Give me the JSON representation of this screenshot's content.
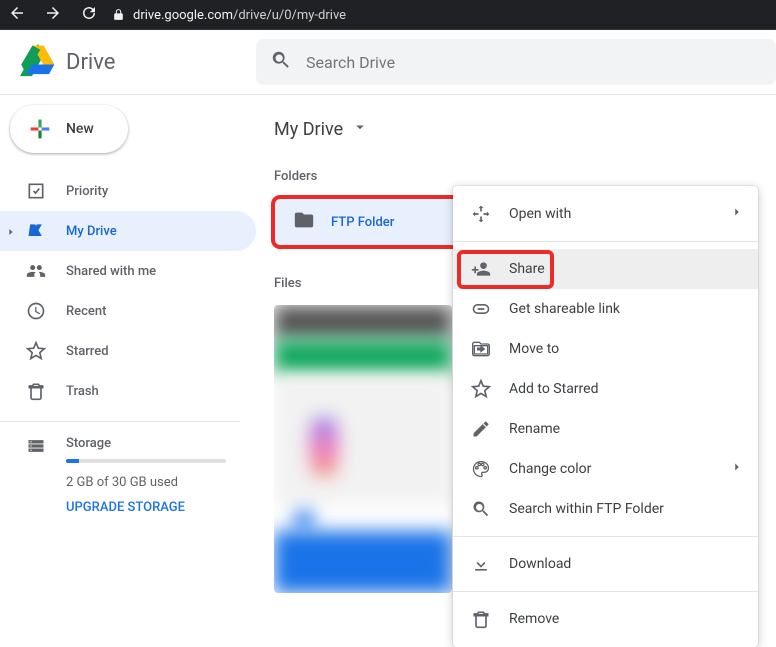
{
  "browser": {
    "url_host": "drive.google.com",
    "url_path": "/drive/u/0/my-drive"
  },
  "header": {
    "app_name": "Drive",
    "search_placeholder": "Search Drive"
  },
  "sidebar": {
    "new_label": "New",
    "items": [
      {
        "label": "Priority"
      },
      {
        "label": "My Drive"
      },
      {
        "label": "Shared with me"
      },
      {
        "label": "Recent"
      },
      {
        "label": "Starred"
      },
      {
        "label": "Trash"
      }
    ],
    "storage": {
      "label": "Storage",
      "used_text": "2 GB of 30 GB used",
      "upgrade_label": "UPGRADE STORAGE"
    }
  },
  "main": {
    "breadcrumb": "My Drive",
    "folders_label": "Folders",
    "files_label": "Files",
    "folders": [
      {
        "name": "FTP Folder"
      }
    ]
  },
  "context_menu": {
    "items": [
      {
        "label": "Open with",
        "icon": "open-with",
        "submenu": true
      },
      {
        "sep": true
      },
      {
        "label": "Share",
        "icon": "share",
        "highlight": true
      },
      {
        "label": "Get shareable link",
        "icon": "link"
      },
      {
        "label": "Move to",
        "icon": "move"
      },
      {
        "label": "Add to Starred",
        "icon": "star"
      },
      {
        "label": "Rename",
        "icon": "rename"
      },
      {
        "label": "Change color",
        "icon": "palette",
        "submenu": true
      },
      {
        "label": "Search within FTP Folder",
        "icon": "search"
      },
      {
        "sep": true
      },
      {
        "label": "Download",
        "icon": "download"
      },
      {
        "sep": true
      },
      {
        "label": "Remove",
        "icon": "trash"
      }
    ]
  }
}
